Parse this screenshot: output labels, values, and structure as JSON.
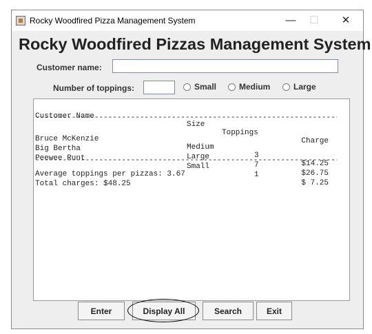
{
  "window": {
    "title": "Rocky Woodfired Pizza Management System",
    "controls": {
      "minimize": "—",
      "maximize": "☐",
      "close": "✕"
    }
  },
  "heading": "Rocky Woodfired Pizzas Management System",
  "form": {
    "customer_label": "Customer name:",
    "customer_value": "",
    "toppings_label": "Number of toppings:",
    "toppings_value": "",
    "sizes": [
      "Small",
      "Medium",
      "Large"
    ],
    "selected_size": null
  },
  "output": {
    "header": {
      "name": "Customer Name",
      "size": "Size",
      "toppings": "Toppings",
      "charge": "Charge"
    },
    "rows": [
      {
        "name": "Bruce McKenzie",
        "size": "Medium",
        "toppings": "3",
        "charge": "$14.25"
      },
      {
        "name": "Big Bertha",
        "size": "Large",
        "toppings": "7",
        "charge": "$26.75"
      },
      {
        "name": "Peewee Runt",
        "size": "Small",
        "toppings": "1",
        "charge": "$ 7.25"
      }
    ],
    "average_line": "Average toppings per pizzas: 3.67",
    "total_line": "Total charges: $48.25"
  },
  "buttons": {
    "enter": "Enter",
    "display_all": "Display All",
    "search": "Search",
    "exit": "Exit"
  },
  "annotation": {
    "highlighted_button": "Display All"
  }
}
